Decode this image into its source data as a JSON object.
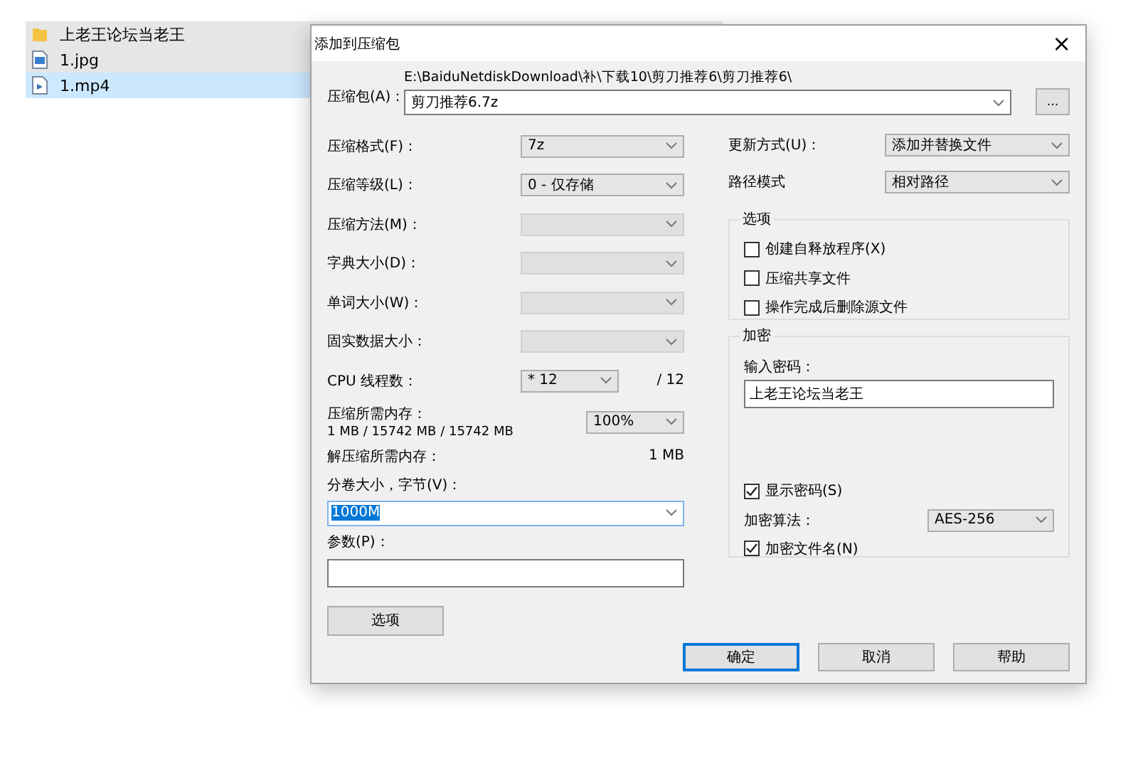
{
  "explorer": {
    "files": [
      {
        "name": "上老王论坛当老王",
        "kind": "folder",
        "selected": false
      },
      {
        "name": "1.jpg",
        "kind": "image",
        "selected": false
      },
      {
        "name": "1.mp4",
        "kind": "video",
        "selected": true
      }
    ]
  },
  "dialog": {
    "title": "添加到压缩包",
    "close": "×",
    "archive": {
      "label": "压缩包(A)：",
      "path": "E:\\BaiduNetdiskDownload\\补\\下载10\\剪刀推荐6\\剪刀推荐6\\",
      "value": "剪刀推荐6.7z",
      "browse": "..."
    },
    "left": [
      {
        "kind": "select",
        "label": "压缩格式(F)：",
        "value": "7z",
        "disabled": false
      },
      {
        "kind": "select",
        "label": "压缩等级(L)：",
        "value": "0 - 仅存储",
        "disabled": false
      },
      {
        "kind": "select",
        "label": "压缩方法(M)：",
        "disabled": true
      },
      {
        "kind": "select",
        "label": "字典大小(D)：",
        "disabled": true
      },
      {
        "kind": "select",
        "label": "单词大小(W)：",
        "disabled": true
      },
      {
        "kind": "select",
        "label": "固实数据大小：",
        "disabled": true
      },
      {
        "kind": "threads",
        "label": "CPU 线程数：",
        "value": "* 12",
        "total": "/ 12"
      },
      {
        "kind": "memory",
        "label": "压缩所需内存：",
        "detail": "1 MB / 15742 MB / 15742 MB",
        "value": "100%"
      },
      {
        "kind": "info",
        "label": "解压缩所需内存：",
        "value": "1 MB"
      },
      {
        "kind": "combo",
        "label": "分卷大小，字节(V)：",
        "value": "1000M"
      },
      {
        "kind": "text",
        "label": "参数(P)："
      }
    ],
    "options_button": "选项",
    "update": {
      "label": "更新方式(U)：",
      "value": "添加并替换文件"
    },
    "path_mode": {
      "label": "路径模式",
      "value": "相对路径"
    },
    "options": {
      "title": "选项",
      "checkboxes": [
        {
          "label": "创建自释放程序(X)",
          "checked": false
        },
        {
          "label": "压缩共享文件",
          "checked": false
        },
        {
          "label": "操作完成后删除源文件",
          "checked": false
        }
      ]
    },
    "encryption": {
      "title": "加密",
      "password_label": "输入密码：",
      "password": "上老王论坛当老王",
      "show_password": {
        "label": "显示密码(S)",
        "checked": true
      },
      "algorithm": {
        "label": "加密算法：",
        "value": "AES-256"
      },
      "encrypt_names": {
        "label": "加密文件名(N)",
        "checked": true
      }
    },
    "buttons": [
      {
        "label": "确定",
        "default": true
      },
      {
        "label": "取消",
        "default": false
      },
      {
        "label": "帮助",
        "default": false
      }
    ]
  }
}
